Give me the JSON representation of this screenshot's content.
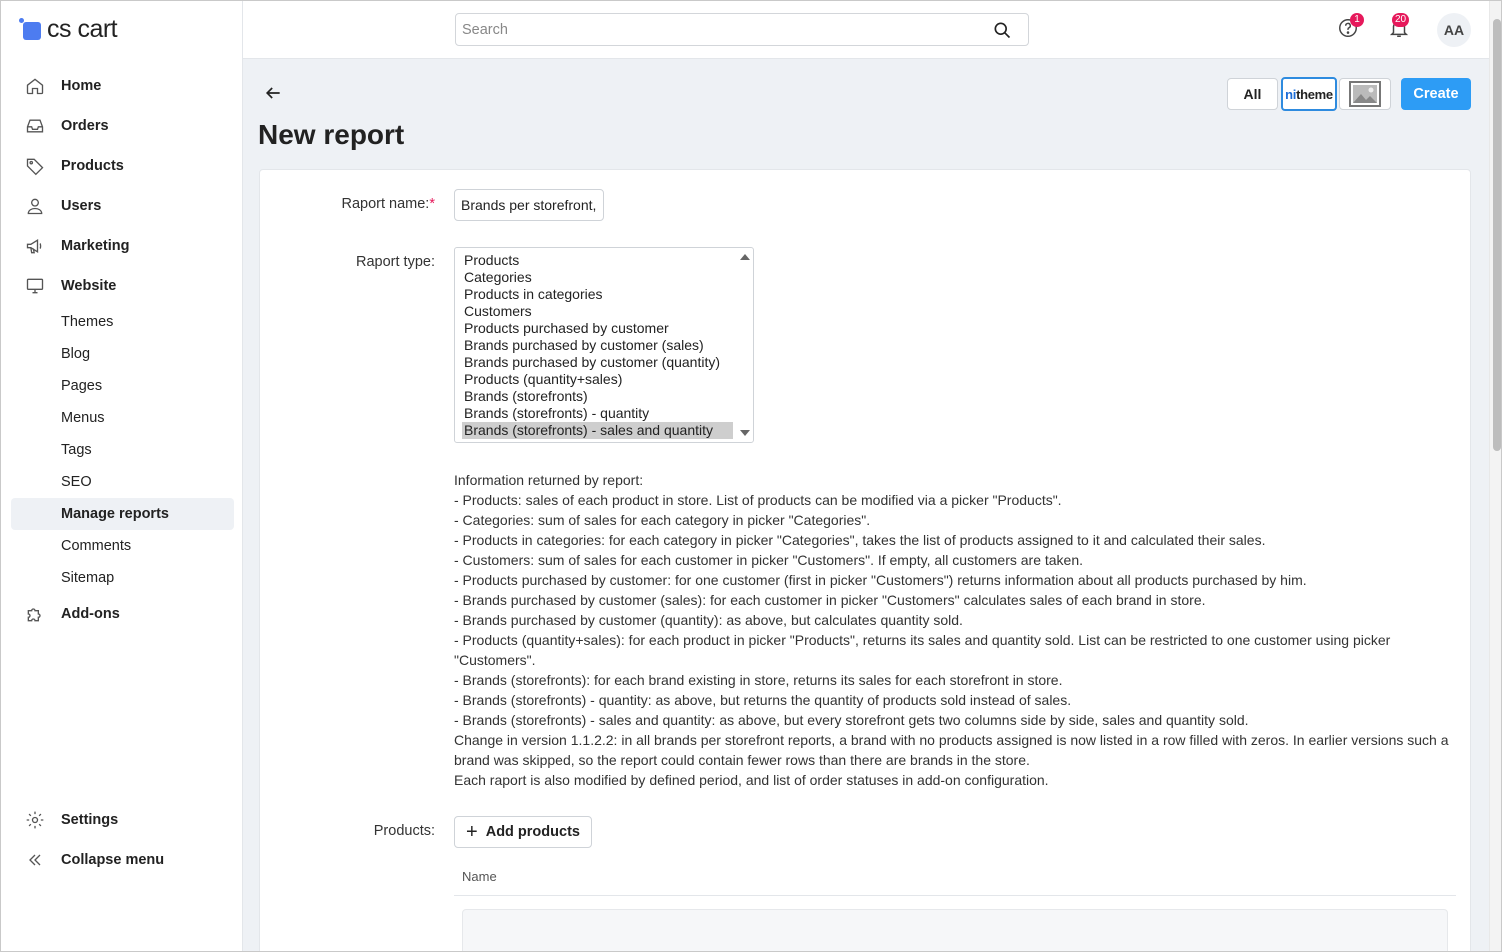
{
  "brand": {
    "name": "cs cart",
    "accent": "#4d7cf0"
  },
  "sidebar": {
    "items": [
      {
        "label": "Home",
        "icon": "home-icon"
      },
      {
        "label": "Orders",
        "icon": "inbox-icon"
      },
      {
        "label": "Products",
        "icon": "tag-icon"
      },
      {
        "label": "Users",
        "icon": "user-icon"
      },
      {
        "label": "Marketing",
        "icon": "megaphone-icon"
      },
      {
        "label": "Website",
        "icon": "monitor-icon"
      }
    ],
    "website_subitems": [
      "Themes",
      "Blog",
      "Pages",
      "Menus",
      "Tags",
      "SEO",
      "Manage reports",
      "Comments",
      "Sitemap"
    ],
    "addons": {
      "label": "Add-ons",
      "icon": "puzzle-icon"
    },
    "settings": {
      "label": "Settings",
      "icon": "gear-icon"
    },
    "collapse": {
      "label": "Collapse menu",
      "icon": "double-chevron-left-icon"
    }
  },
  "header": {
    "search_placeholder": "Search",
    "help_badge": "1",
    "notifications_badge": "20",
    "avatar_initials": "AA"
  },
  "page": {
    "title": "New report",
    "buttons": {
      "all": "All",
      "theme_pre": "ni",
      "theme_main": "theme",
      "create": "Create"
    }
  },
  "form": {
    "name_label": "Raport name:",
    "name_required": "*",
    "name_value": "Brands per storefront,",
    "type_label": "Raport type:",
    "type_options": [
      "Products",
      "Categories",
      "Products in categories",
      "Customers",
      "Products purchased by customer",
      "Brands purchased by customer (sales)",
      "Brands purchased by customer (quantity)",
      "Products (quantity+sales)",
      "Brands (storefronts)",
      "Brands (storefronts) - quantity",
      "Brands (storefronts) - sales and quantity"
    ],
    "type_selected_index": 10,
    "info_lines": [
      "Information returned by report:",
      "- Products: sales of each product in store. List of products can be modified via a picker \"Products\".",
      "- Categories: sum of sales for each category in picker \"Categories\".",
      "- Products in categories: for each category in picker \"Categories\", takes the list of products assigned to it and calculated their sales.",
      "- Customers: sum of sales for each customer in picker \"Customers\". If empty, all customers are taken.",
      "- Products purchased by customer: for one customer (first in picker \"Customers\") returns information about all products purchased by him.",
      "- Brands purchased by customer (sales): for each customer in picker \"Customers\" calculates sales of each brand in store.",
      "- Brands purchased by customer (quantity): as above, but calculates quantity sold.",
      "- Products (quantity+sales): for each product in picker \"Products\", returns its sales and quantity sold. List can be restricted to one customer using picker \"Customers\".",
      "- Brands (storefronts): for each brand existing in store, returns its sales for each storefront in store.",
      "- Brands (storefronts) - quantity: as above, but returns the quantity of products sold instead of sales.",
      "- Brands (storefronts) - sales and quantity: as above, but every storefront gets two columns side by side, sales and quantity sold.",
      "Change in version 1.1.2.2: in all brands per storefront reports, a brand with no products assigned is now listed in a row filled with zeros. In earlier versions such a brand was skipped, so the report could contain fewer rows than there are brands in the store.",
      "Each raport is also modified by defined period, and list of order statuses in add-on configuration."
    ],
    "products_label": "Products:",
    "add_products": "Add products",
    "column_name": "Name"
  },
  "colors": {
    "primary_button": "#2d9cf5",
    "badge": "#e6195b",
    "selected_option": "#cecece"
  }
}
